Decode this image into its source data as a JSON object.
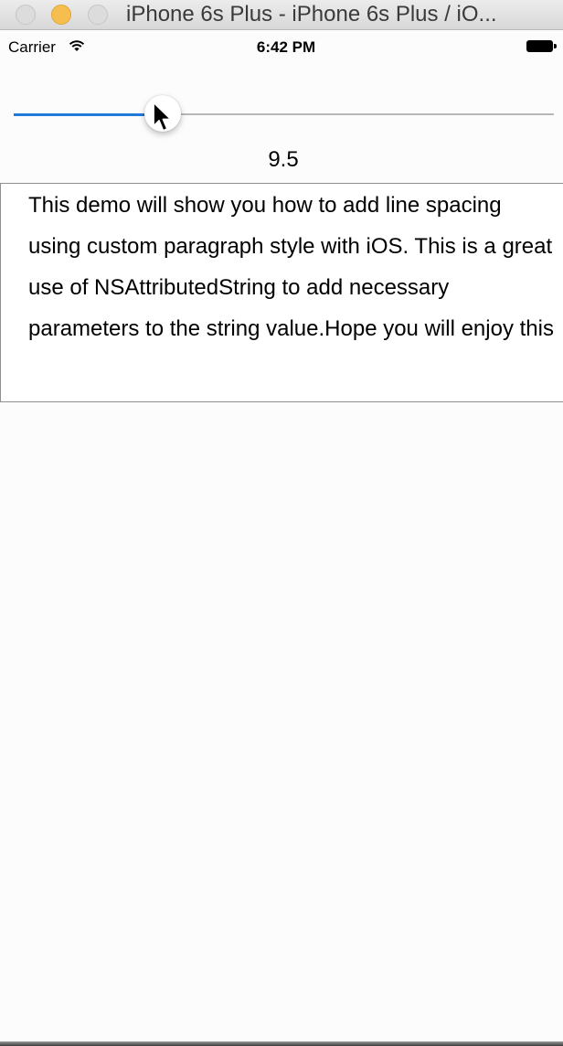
{
  "window": {
    "title": "iPhone 6s Plus - iPhone 6s Plus / iO..."
  },
  "statusbar": {
    "carrier": "Carrier",
    "time": "6:42 PM",
    "icons": [
      "wifi-icon",
      "battery-icon"
    ]
  },
  "slider": {
    "fraction": 0.275,
    "value_label": "9.5",
    "accent_color": "#1f7ad9"
  },
  "textview": {
    "text": "This demo will show you how to add line spacing using custom paragraph style with iOS. This is a great use of NSAttributedString to add necessary parameters to the string value.Hope you will enjoy this"
  }
}
